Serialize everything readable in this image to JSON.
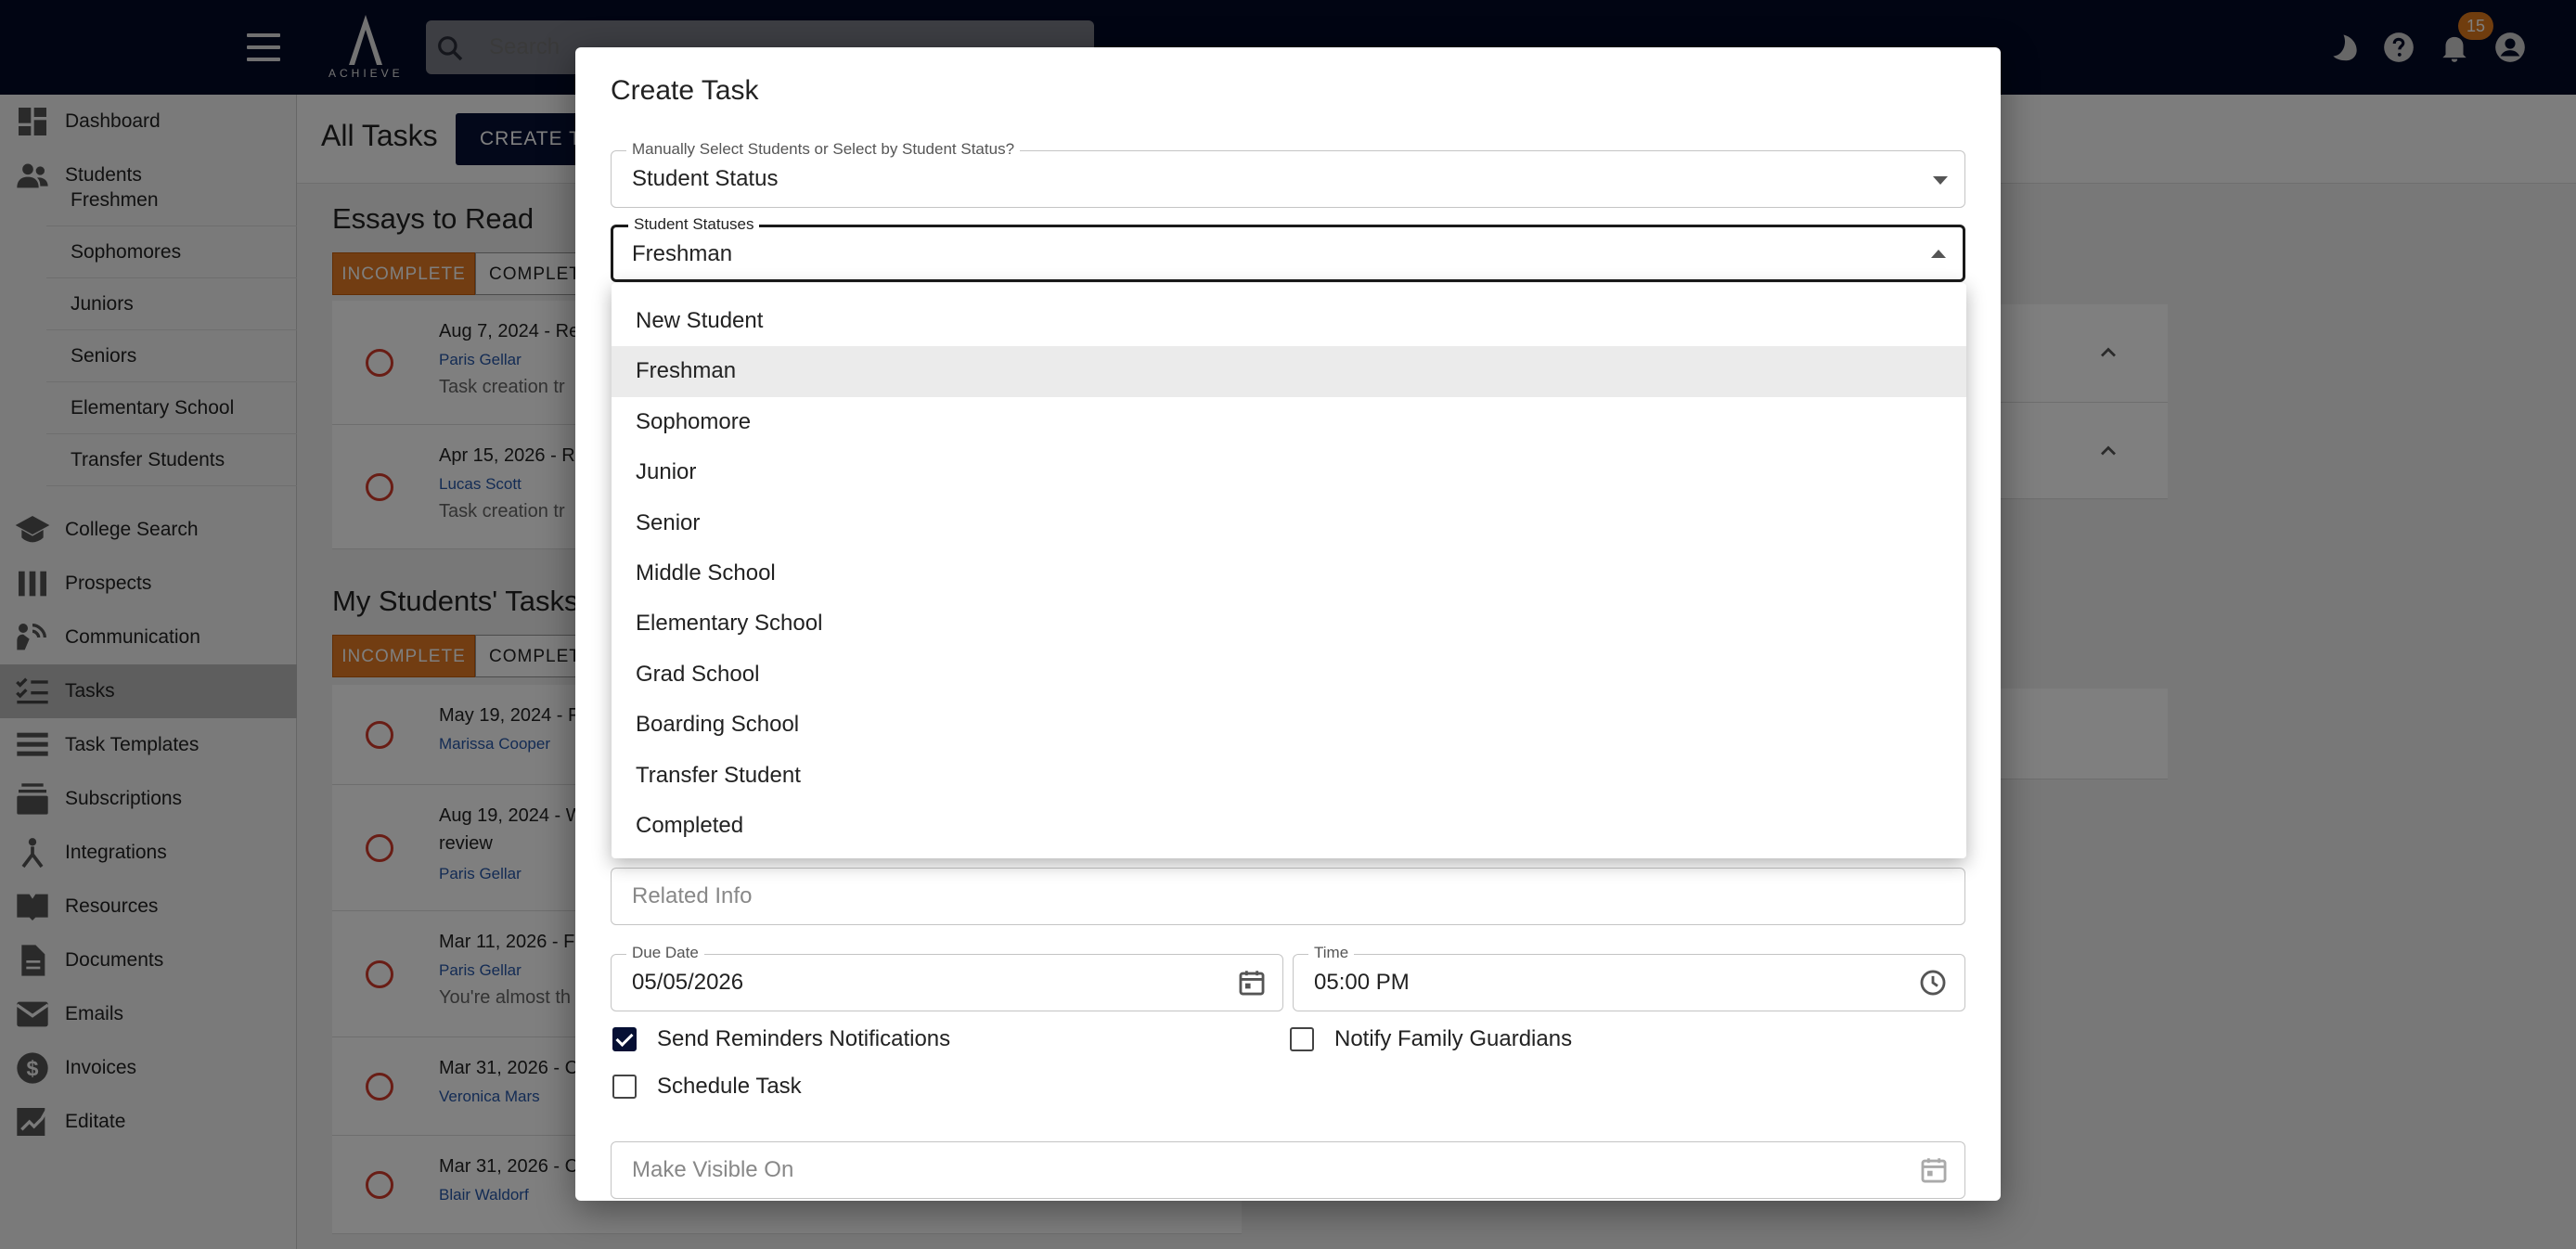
{
  "topbar": {
    "logo_text": "ACHIEVE",
    "search_placeholder": "Search",
    "notification_count": "15"
  },
  "sidebar": {
    "items": [
      {
        "label": "Dashboard",
        "icon": "dashboard-icon"
      },
      {
        "label": "Students",
        "icon": "students-icon"
      },
      {
        "label": "College Search",
        "icon": "school-icon"
      },
      {
        "label": "Prospects",
        "icon": "prospects-icon"
      },
      {
        "label": "Communication",
        "icon": "communication-icon"
      },
      {
        "label": "Tasks",
        "icon": "tasks-icon",
        "active": true
      },
      {
        "label": "Task Templates",
        "icon": "templates-icon"
      },
      {
        "label": "Subscriptions",
        "icon": "subscriptions-icon"
      },
      {
        "label": "Integrations",
        "icon": "integrations-icon"
      },
      {
        "label": "Resources",
        "icon": "resources-icon"
      },
      {
        "label": "Documents",
        "icon": "documents-icon"
      },
      {
        "label": "Emails",
        "icon": "email-icon"
      },
      {
        "label": "Invoices",
        "icon": "invoice-icon"
      },
      {
        "label": "Editate",
        "icon": "editate-icon"
      }
    ],
    "student_subitems": [
      "Freshmen",
      "Sophomores",
      "Juniors",
      "Seniors",
      "Elementary School",
      "Transfer Students"
    ]
  },
  "main": {
    "title": "All Tasks",
    "create_button": "CREATE TASK",
    "essays_title": "Essays to Read",
    "my_students_title": "My Students' Tasks",
    "tab_incomplete": "INCOMPLETE",
    "tab_complete": "COMPLETE",
    "essay_tasks": [
      {
        "title": "Aug 7, 2024 - Re",
        "user": "Paris Gellar",
        "desc": "Task creation tr"
      },
      {
        "title": "Apr 15, 2026 - R",
        "user": "Lucas Scott",
        "desc": "Task creation tr"
      }
    ],
    "student_tasks": [
      {
        "title": "May 19, 2024 - F",
        "user": "Marissa Cooper",
        "desc": ""
      },
      {
        "title": "Aug 19, 2024 - W",
        "title2": "review",
        "user": "Paris Gellar",
        "desc": ""
      },
      {
        "title": "Mar 11, 2026 - F",
        "user": "Paris Gellar",
        "desc": "You're almost th"
      },
      {
        "title": "Mar 31, 2026 - C",
        "user": "Veronica Mars",
        "desc": ""
      },
      {
        "title": "Mar 31, 2026 - C",
        "user": "Blair Waldorf",
        "desc": ""
      }
    ]
  },
  "dialog": {
    "title": "Create Task",
    "select_mode_label": "Manually Select Students or Select by Student Status?",
    "select_mode_value": "Student Status",
    "statuses_label": "Student Statuses",
    "statuses_value": "Freshman",
    "status_options": [
      "New Student",
      "Freshman",
      "Sophomore",
      "Junior",
      "Senior",
      "Middle School",
      "Elementary School",
      "Grad School",
      "Boarding School",
      "Transfer Student",
      "Completed"
    ],
    "selected_option": "Freshman",
    "related_info_placeholder": "Related Info",
    "due_date_label": "Due Date",
    "due_date_value": "05/05/2026",
    "time_label": "Time",
    "time_value": "05:00 PM",
    "send_reminders_label": "Send Reminders Notifications",
    "send_reminders_checked": true,
    "notify_guardians_label": "Notify Family Guardians",
    "notify_guardians_checked": false,
    "schedule_task_label": "Schedule Task",
    "schedule_task_checked": false,
    "make_visible_placeholder": "Make Visible On"
  },
  "colors": {
    "topbar_bg": "#020a27",
    "accent_orange": "#e57b24",
    "primary_navy": "#061034",
    "link_blue": "#2657a8",
    "task_circle_red": "#d23b2a"
  }
}
